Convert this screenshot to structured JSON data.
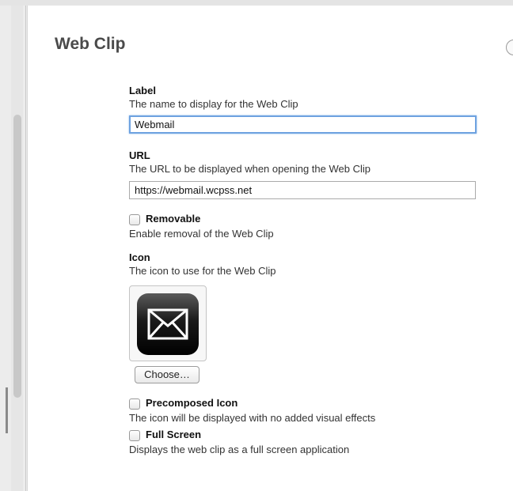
{
  "payload": {
    "title": "Web Clip",
    "collapse_symbol": "−"
  },
  "fields": {
    "label": {
      "title": "Label",
      "description": "The name to display for the Web Clip",
      "value": "Webmail"
    },
    "url": {
      "title": "URL",
      "description": "The URL to be displayed when opening the Web Clip",
      "value": "https://webmail.wcpss.net"
    },
    "removable": {
      "title": "Removable",
      "description": "Enable removal of the Web Clip",
      "checked": false
    },
    "icon": {
      "title": "Icon",
      "description": "The icon to use for the Web Clip",
      "image": "envelope-icon",
      "choose_label": "Choose…"
    },
    "precomposed": {
      "title": "Precomposed Icon",
      "description": "The icon will be displayed with no added visual effects",
      "checked": false
    },
    "full_screen": {
      "title": "Full Screen",
      "description": "Displays the web clip as a full screen application",
      "checked": false
    }
  },
  "colors": {
    "focus_ring": "#6ea2e0",
    "title_text": "#4a4a4a"
  }
}
